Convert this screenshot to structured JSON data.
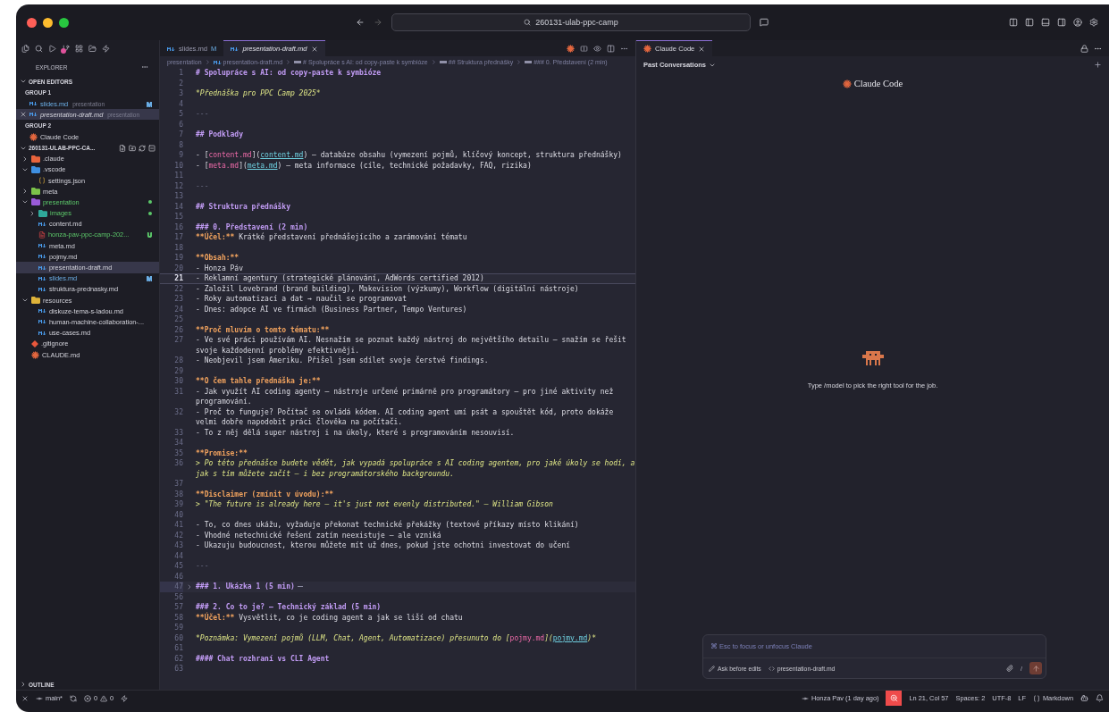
{
  "window": {
    "search": "260131-ulab-ppc-camp"
  },
  "sidebar": {
    "title": "EXPLORER",
    "open_editors": {
      "title": "OPEN EDITORS",
      "groups": [
        {
          "title": "GROUP 1",
          "items": [
            {
              "label": "slides.md",
              "description": "presentation",
              "badge": "M",
              "kind": "md",
              "selected": false
            },
            {
              "label": "presentation-draft.md",
              "description": "presentation",
              "kind": "md",
              "selected": true
            }
          ]
        },
        {
          "title": "GROUP 2",
          "items": [
            {
              "label": "Claude Code",
              "kind": "claude",
              "selected": false
            }
          ]
        }
      ]
    },
    "project": "260131-ULAB-PPC-CA...",
    "tree": [
      {
        "label": ".claude",
        "kind": "folder",
        "icon": {
          "color": "#e8643c"
        },
        "expanded": false,
        "selected": false
      },
      {
        "label": ".vscode",
        "kind": "folder",
        "icon": {
          "color": "#3f8fe0"
        },
        "expanded": true,
        "selected": false,
        "children": [
          {
            "label": "settings.json",
            "kind": "json",
            "selected": false
          }
        ]
      },
      {
        "label": "meta",
        "kind": "folder",
        "icon": {
          "color": "#7cc24a"
        },
        "expanded": false,
        "selected": false
      },
      {
        "label": "presentation",
        "kind": "folder",
        "icon": {
          "color": "#9a5ad8"
        },
        "expanded": true,
        "selected": false,
        "color": "#5cc86a",
        "children": [
          {
            "label": "images",
            "kind": "folder",
            "icon": {
              "color": "#2fa89a"
            },
            "expanded": false,
            "selected": false,
            "color": "#5cc86a"
          },
          {
            "label": "content.md",
            "kind": "md",
            "selected": false
          },
          {
            "label": "honza-pav-ppc-camp-202...",
            "kind": "pdf",
            "selected": false,
            "color": "#5cc86a",
            "badge": "U"
          },
          {
            "label": "meta.md",
            "kind": "md",
            "selected": false
          },
          {
            "label": "pojmy.md",
            "kind": "md",
            "selected": false
          },
          {
            "label": "presentation-draft.md",
            "kind": "md",
            "selected": true
          },
          {
            "label": "slides.md",
            "kind": "md",
            "selected": false,
            "color": "#6cb0e8",
            "badge": "M"
          },
          {
            "label": "struktura-prednasky.md",
            "kind": "md",
            "selected": false
          }
        ]
      },
      {
        "label": "resources",
        "kind": "folder",
        "icon": {
          "color": "#e0b43a"
        },
        "expanded": true,
        "selected": false,
        "children": [
          {
            "label": "diskuze-tema-s-ladou.md",
            "kind": "md",
            "selected": false
          },
          {
            "label": "human-machine-collaboration-...",
            "kind": "md",
            "selected": false
          },
          {
            "label": "use-cases.md",
            "kind": "md",
            "selected": false
          }
        ]
      },
      {
        "label": ".gitignore",
        "kind": "git",
        "selected": false
      },
      {
        "label": "CLAUDE.md",
        "kind": "claude",
        "selected": false
      }
    ],
    "outline": "OUTLINE"
  },
  "editor": {
    "tabs": [
      {
        "label": "slides.md",
        "badge": "M",
        "selected": false
      },
      {
        "label": "presentation-draft.md",
        "selected": true
      }
    ],
    "breadcrumbs": [
      {
        "label": "presentation",
        "kind": "folder"
      },
      {
        "label": "presentation-draft.md",
        "kind": "md"
      },
      {
        "label": "# Spolupráce s AI: od copy-paste k symbióze",
        "kind": "symbol"
      },
      {
        "label": "## Struktura přednášky",
        "kind": "symbol"
      },
      {
        "label": "### 0. Představení (2 min)",
        "kind": "symbol"
      }
    ],
    "lines": [
      {
        "n": "1",
        "current": false,
        "folded": false,
        "segments": [
          {
            "kind": "heading",
            "text": "# Spolupráce s AI: od copy-paste k symbióze"
          }
        ]
      },
      {
        "n": "2",
        "current": false,
        "folded": false
      },
      {
        "n": "3",
        "current": false,
        "folded": false,
        "segments": [
          {
            "kind": "italic",
            "text": "*Přednáška pro PPC Camp 2025*"
          }
        ]
      },
      {
        "n": "4",
        "current": false,
        "folded": false
      },
      {
        "n": "5",
        "current": false,
        "folded": false,
        "segments": [
          {
            "kind": "rule",
            "text": "---"
          }
        ]
      },
      {
        "n": "6",
        "current": false,
        "folded": false
      },
      {
        "n": "7",
        "current": false,
        "folded": false,
        "segments": [
          {
            "kind": "heading",
            "text": "## Podklady"
          }
        ]
      },
      {
        "n": "8",
        "current": false,
        "folded": false
      },
      {
        "n": "9",
        "current": false,
        "folded": false,
        "segments": [
          {
            "kind": "plain",
            "text": "- ["
          },
          {
            "kind": "link-text",
            "text": "content.md"
          },
          {
            "kind": "plain",
            "text": "]("
          },
          {
            "kind": "link-url",
            "text": "content.md"
          },
          {
            "kind": "plain",
            "text": ") – databáze obsahu (vymezení pojmů, klíčový koncept, struktura přednášky)"
          }
        ]
      },
      {
        "n": "10",
        "current": false,
        "folded": false,
        "segments": [
          {
            "kind": "plain",
            "text": "- ["
          },
          {
            "kind": "link-text",
            "text": "meta.md"
          },
          {
            "kind": "plain",
            "text": "]("
          },
          {
            "kind": "link-url",
            "text": "meta.md"
          },
          {
            "kind": "plain",
            "text": ") – meta informace (cíle, technické požadavky, FAQ, rizika)"
          }
        ]
      },
      {
        "n": "11",
        "current": false,
        "folded": false
      },
      {
        "n": "12",
        "current": false,
        "folded": false,
        "segments": [
          {
            "kind": "rule",
            "text": "---"
          }
        ]
      },
      {
        "n": "13",
        "current": false,
        "folded": false
      },
      {
        "n": "14",
        "current": false,
        "folded": false,
        "segments": [
          {
            "kind": "heading",
            "text": "## Struktura přednášky"
          }
        ]
      },
      {
        "n": "15",
        "current": false,
        "folded": false
      },
      {
        "n": "16",
        "current": false,
        "folded": false,
        "segments": [
          {
            "kind": "heading",
            "text": "### 0. Představení (2 min)"
          }
        ]
      },
      {
        "n": "17",
        "current": false,
        "folded": false,
        "segments": [
          {
            "kind": "bold",
            "text": "**Účel:**"
          },
          {
            "kind": "plain",
            "text": " Krátké představení přednášejícího a zarámování tématu"
          }
        ]
      },
      {
        "n": "18",
        "current": false,
        "folded": false
      },
      {
        "n": "19",
        "current": false,
        "folded": false,
        "segments": [
          {
            "kind": "bold",
            "text": "**Obsah:**"
          }
        ]
      },
      {
        "n": "20",
        "current": false,
        "folded": false,
        "segments": [
          {
            "kind": "plain",
            "text": "- Honza Páv"
          }
        ]
      },
      {
        "n": "21",
        "current": true,
        "folded": false,
        "segments": [
          {
            "kind": "plain",
            "text": "- Reklamní agentury (strategické plánování, AdWords certified 2012)"
          }
        ]
      },
      {
        "n": "22",
        "current": false,
        "folded": false,
        "segments": [
          {
            "kind": "plain",
            "text": "- Založil Lovebrand (brand building), Makevision (výzkumy), Workflow (digitální nástroje)"
          }
        ]
      },
      {
        "n": "23",
        "current": false,
        "folded": false,
        "segments": [
          {
            "kind": "plain",
            "text": "- Roky automatizací a dat → naučil se programovat"
          }
        ]
      },
      {
        "n": "24",
        "current": false,
        "folded": false,
        "segments": [
          {
            "kind": "plain",
            "text": "- Dnes: adopce AI ve firmách (Business Partner, Tempo Ventures)"
          }
        ]
      },
      {
        "n": "25",
        "current": false,
        "folded": false
      },
      {
        "n": "26",
        "current": false,
        "folded": false,
        "segments": [
          {
            "kind": "bold",
            "text": "**Proč mluvím o tomto tématu:**"
          }
        ]
      },
      {
        "n": "27",
        "current": false,
        "folded": false,
        "segments": [
          {
            "kind": "plain",
            "text": "- Ve své práci používám AI. Nesnažím se poznat každý nástroj do největšího detailu – snažím se řešit svoje každodenní problémy efektivněji."
          }
        ]
      },
      {
        "n": "28",
        "current": false,
        "folded": false,
        "segments": [
          {
            "kind": "plain",
            "text": "- Neobjevil jsem Ameriku. Přišel jsem sdílet svoje čerstvé findings."
          }
        ]
      },
      {
        "n": "29",
        "current": false,
        "folded": false
      },
      {
        "n": "30",
        "current": false,
        "folded": false,
        "segments": [
          {
            "kind": "bold",
            "text": "**O čem tahle přednáška je:**"
          }
        ]
      },
      {
        "n": "31",
        "current": false,
        "folded": false,
        "segments": [
          {
            "kind": "plain",
            "text": "- Jak využít AI coding agenty – nástroje určené primárně pro programátory – pro jiné aktivity než programování."
          }
        ]
      },
      {
        "n": "32",
        "current": false,
        "folded": false,
        "segments": [
          {
            "kind": "plain",
            "text": "- Proč to funguje? Počítač se ovládá kódem. AI coding agent umí psát a spouštět kód, proto dokáže velmi dobře napodobit práci člověka na počítači."
          }
        ]
      },
      {
        "n": "33",
        "current": false,
        "folded": false,
        "segments": [
          {
            "kind": "plain",
            "text": "- To z něj dělá super nástroj i na úkoly, které s programováním nesouvisí."
          }
        ]
      },
      {
        "n": "34",
        "current": false,
        "folded": false
      },
      {
        "n": "35",
        "current": false,
        "folded": false,
        "segments": [
          {
            "kind": "bold",
            "text": "**Promise:**"
          }
        ]
      },
      {
        "n": "36",
        "current": false,
        "folded": false,
        "segments": [
          {
            "kind": "italic",
            "text": "> Po této přednášce budete vědět, jak vypadá spolupráce s AI coding agentem, pro jaké úkoly se hodí, a jak s tím můžete začít – i bez programátorského backgroundu."
          }
        ]
      },
      {
        "n": "37",
        "current": false,
        "folded": false
      },
      {
        "n": "38",
        "current": false,
        "folded": false,
        "segments": [
          {
            "kind": "bold",
            "text": "**Disclaimer (zmínit v úvodu):**"
          }
        ]
      },
      {
        "n": "39",
        "current": false,
        "folded": false,
        "segments": [
          {
            "kind": "italic",
            "text": "> \"The future is already here – it's just not evenly distributed.\" – William Gibson"
          }
        ]
      },
      {
        "n": "40",
        "current": false,
        "folded": false
      },
      {
        "n": "41",
        "current": false,
        "folded": false,
        "segments": [
          {
            "kind": "plain",
            "text": "- To, co dnes ukážu, vyžaduje překonat technické překážky (textové příkazy místo klikání)"
          }
        ]
      },
      {
        "n": "42",
        "current": false,
        "folded": false,
        "segments": [
          {
            "kind": "plain",
            "text": "- Vhodné netechnické řešení zatím neexistuje – ale vzniká"
          }
        ]
      },
      {
        "n": "43",
        "current": false,
        "folded": false,
        "segments": [
          {
            "kind": "plain",
            "text": "- Ukazuju budoucnost, kterou můžete mít už dnes, pokud jste ochotni investovat do učení"
          }
        ]
      },
      {
        "n": "44",
        "current": false,
        "folded": false
      },
      {
        "n": "45",
        "current": false,
        "folded": false,
        "segments": [
          {
            "kind": "rule",
            "text": "---"
          }
        ]
      },
      {
        "n": "46",
        "current": false,
        "folded": false
      },
      {
        "n": "47",
        "current": false,
        "folded": true,
        "segments": [
          {
            "kind": "heading",
            "text": "### 1. Ukázka 1 (5 min)"
          }
        ]
      },
      {
        "n": "56",
        "current": false,
        "folded": false
      },
      {
        "n": "57",
        "current": false,
        "folded": false,
        "segments": [
          {
            "kind": "heading",
            "text": "### 2. Co to je? – Technický základ (5 min)"
          }
        ]
      },
      {
        "n": "58",
        "current": false,
        "folded": false,
        "segments": [
          {
            "kind": "bold",
            "text": "**Účel:**"
          },
          {
            "kind": "plain",
            "text": " Vysvětlit, co je coding agent a jak se liší od chatu"
          }
        ]
      },
      {
        "n": "59",
        "current": false,
        "folded": false
      },
      {
        "n": "60",
        "current": false,
        "folded": false,
        "segments": [
          {
            "kind": "italic",
            "text": "*Poznámka: Vymezení pojmů (LLM, Chat, Agent, Automatizace) přesunuto do ["
          },
          {
            "kind": "link-text",
            "text": "pojmy.md"
          },
          {
            "kind": "italic",
            "text": "]("
          },
          {
            "kind": "link-url",
            "text": "pojmy.md"
          },
          {
            "kind": "italic",
            "text": ")*"
          }
        ]
      },
      {
        "n": "61",
        "current": false,
        "folded": false
      },
      {
        "n": "62",
        "current": false,
        "folded": false,
        "segments": [
          {
            "kind": "heading",
            "text": "#### Chat rozhraní vs CLI Agent"
          }
        ]
      },
      {
        "n": "63",
        "current": false,
        "folded": false
      }
    ]
  },
  "panel": {
    "tab": "Claude Code",
    "history": "Past Conversations",
    "logo": "Claude Code",
    "hint": "Type /model to pick the right tool for the job.",
    "input": {
      "placeholder": "⌘ Esc to focus or unfocus Claude",
      "mode": "Ask before edits",
      "file": "presentation-draft.md",
      "slash": "/"
    }
  },
  "status_bar": {
    "branch": "main*",
    "errors": "0",
    "warnings": "0",
    "blame": "Honza Pav (1 day ago)",
    "position": "Ln 21, Col 57",
    "spaces": "Spaces: 2",
    "encoding": "UTF-8",
    "eol": "LF",
    "language": "Markdown"
  }
}
